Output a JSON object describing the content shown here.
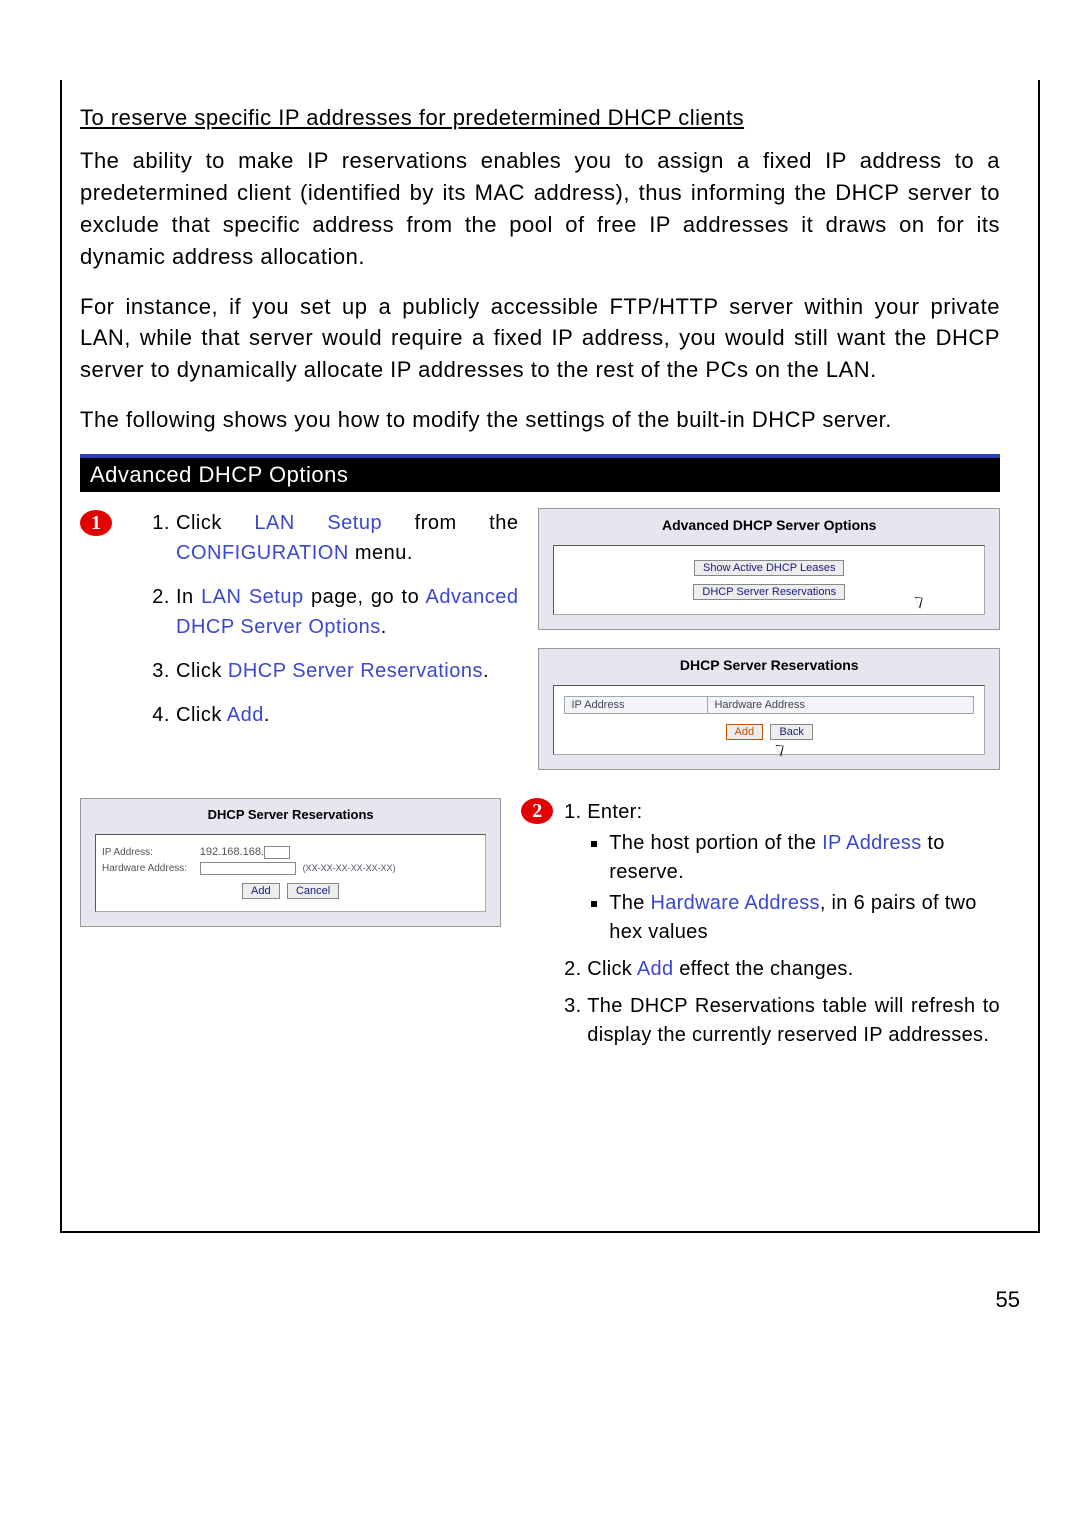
{
  "section_title": "To reserve specific IP addresses for predetermined DHCP clients",
  "para1": "The ability to make IP reservations enables you to assign a fixed IP address to a predetermined client (identified by its MAC address), thus informing the DHCP server to exclude that specific address from the pool of free IP addresses it draws on for its dynamic address allocation.",
  "para2": "For instance, if you set up a publicly accessible FTP/HTTP server within your private LAN, while that server would require a fixed IP address, you would still want the DHCP server to dynamically allocate IP addresses to the rest of the PCs on the LAN.",
  "para3": "The following shows you how to modify the settings of the built-in DHCP server.",
  "options_bar": "Advanced DHCP Options",
  "badge1": "1",
  "badge2": "2",
  "step1": {
    "pre_a": "Click ",
    "hl_a": "LAN Setup",
    "post_a": " from the ",
    "hl_b": "CONFIGURATION",
    "post_b": " menu."
  },
  "step2": {
    "pre_a": "In ",
    "hl_a": "LAN Setup",
    "mid": " page, go to ",
    "hl_b": "Advanced DHCP Server Options",
    "post": "."
  },
  "step3": {
    "pre": "Click ",
    "hl": "DHCP Server Reservations",
    "post": "."
  },
  "step4": {
    "pre": "Click ",
    "hl": "Add",
    "post": "."
  },
  "panel_a": {
    "title": "Advanced DHCP Server Options",
    "btn1": "Show Active DHCP Leases",
    "btn2": "DHCP Server Reservations"
  },
  "panel_b": {
    "title": "DHCP Server Reservations",
    "col1": "IP Address",
    "col2": "Hardware Address",
    "btn_add": "Add",
    "btn_back": "Back"
  },
  "panel_c": {
    "title": "DHCP Server Reservations",
    "label_ip": "IP Address:",
    "value_ip": "192.168.168.",
    "label_hw": "Hardware Address:",
    "hint_hw": "(XX-XX-XX-XX-XX-XX)",
    "btn_add": "Add",
    "btn_cancel": "Cancel"
  },
  "right2": {
    "s1_lead": "Enter:",
    "b1_pre": "The host portion of the ",
    "b1_hl": "IP Address",
    "b1_post": " to reserve.",
    "b2_pre": "The ",
    "b2_hl": "Hardware Address",
    "b2_post": ", in 6 pairs of two hex values",
    "s2_pre": "Click ",
    "s2_hl": "Add",
    "s2_post": " effect the changes.",
    "s3": "The DHCP Reservations table will refresh to display the currently reserved IP addresses."
  },
  "page_number": "55"
}
